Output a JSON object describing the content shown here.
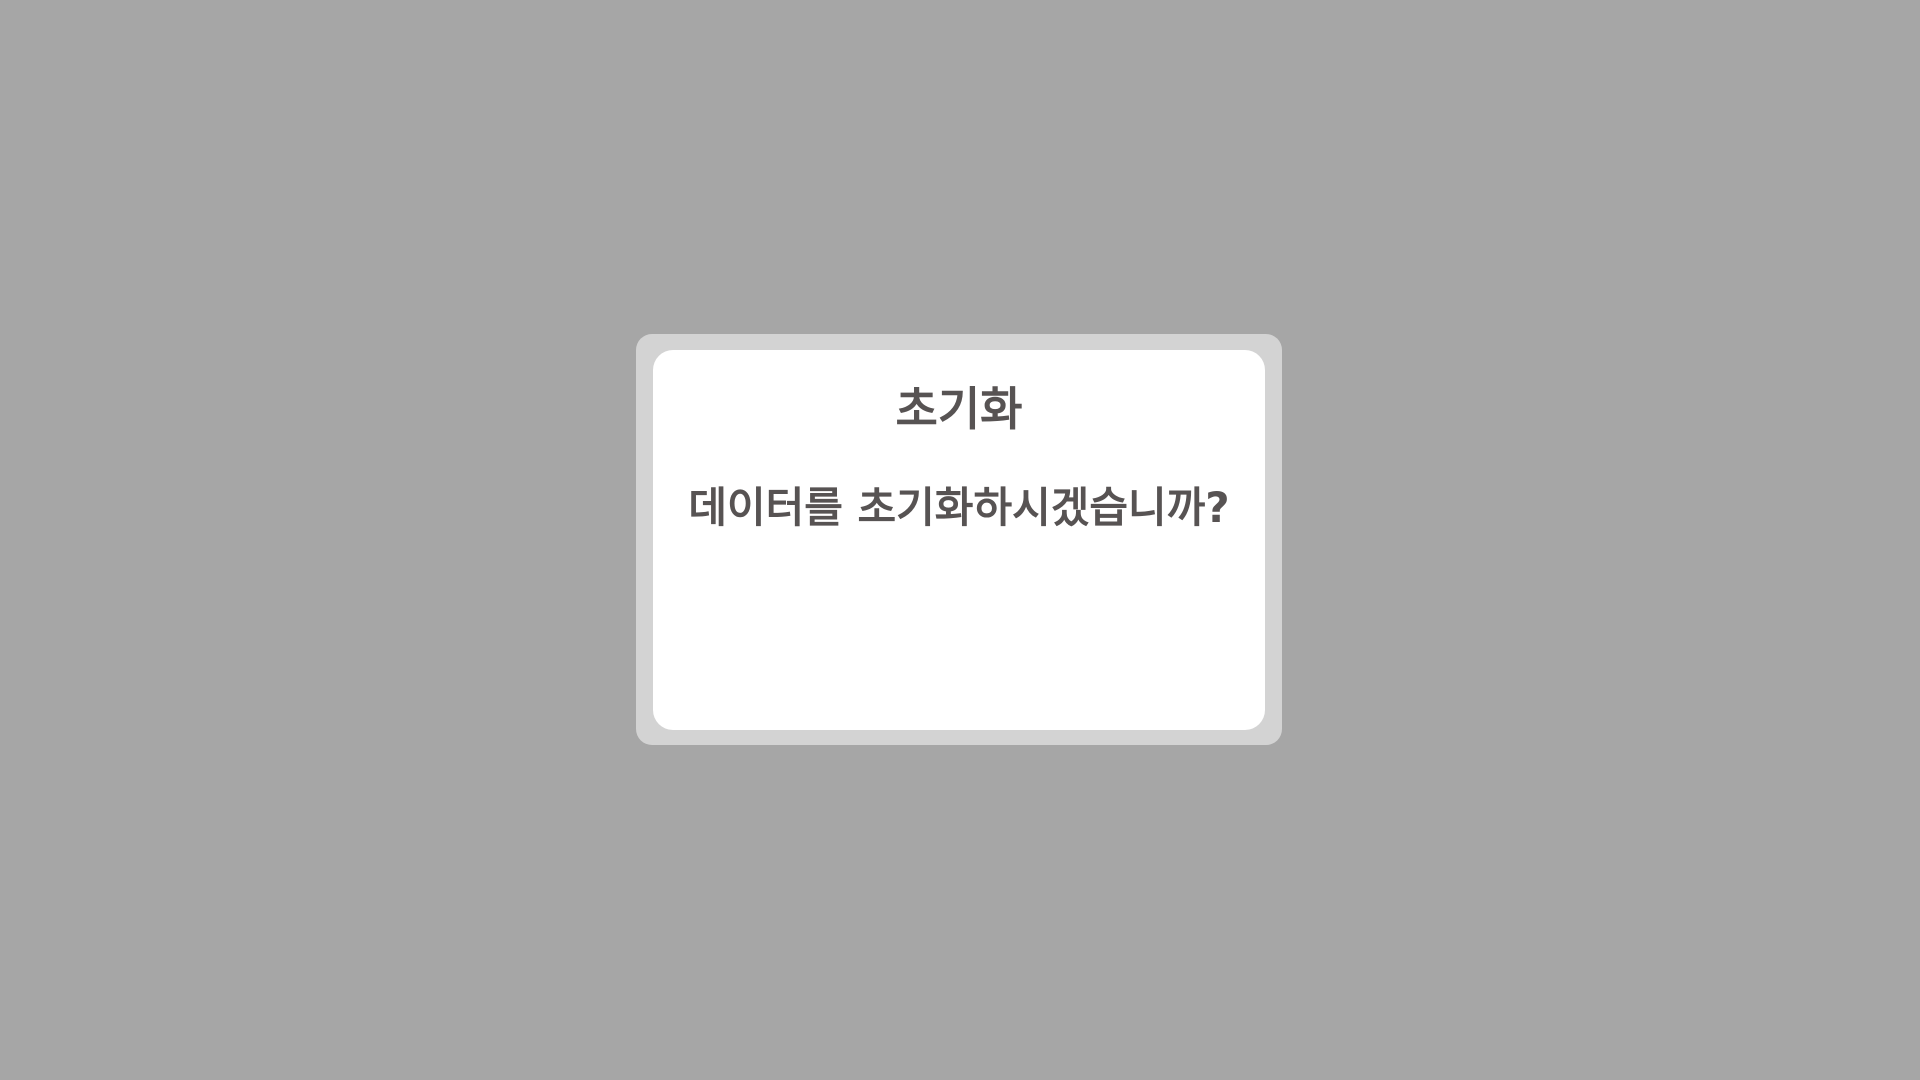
{
  "dialog": {
    "title": "초기화",
    "message": "데이터를 초기화하시겠습니까?"
  },
  "colors": {
    "backdrop": "#a6a6a6",
    "frame": "#d3d3d3",
    "panel": "#ffffff",
    "text": "#575353"
  }
}
